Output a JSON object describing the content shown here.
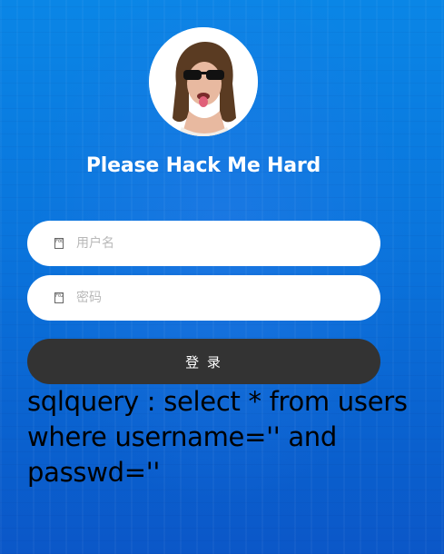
{
  "page": {
    "title": "Please Hack Me Hard"
  },
  "avatar": {
    "icon": "profile-photo"
  },
  "form": {
    "username_placeholder": "用户名",
    "password_placeholder": "密码",
    "username_icon_glyph": "F001",
    "password_icon_glyph": "F023",
    "login_label": "登 录"
  },
  "output": {
    "sql_text": "sqlquery : select * from users where username='' and passwd=''"
  },
  "colors": {
    "background_top": "#0a86e6",
    "background_bottom": "#0b57c8",
    "button": "#333333",
    "field": "#ffffff"
  }
}
